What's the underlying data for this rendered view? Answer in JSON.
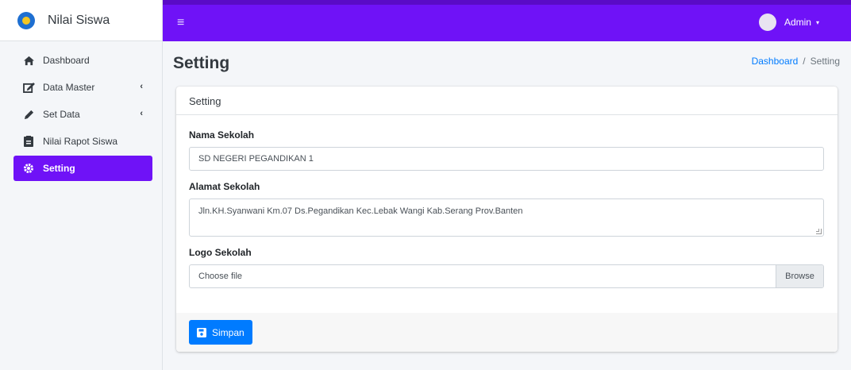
{
  "brand": {
    "name": "Nilai Siswa"
  },
  "sidebar": {
    "items": [
      {
        "label": "Dashboard",
        "icon": "home-icon"
      },
      {
        "label": "Data Master",
        "icon": "edit-icon",
        "caret": "‹"
      },
      {
        "label": "Set Data",
        "icon": "pencil-icon",
        "caret": "‹"
      },
      {
        "label": "Nilai Rapot Siswa",
        "icon": "clipboard-icon"
      },
      {
        "label": "Setting",
        "icon": "gear-icon",
        "active": true
      }
    ]
  },
  "topbar": {
    "menu_icon": "≡",
    "user_name": "Admin",
    "user_caret": "▾"
  },
  "page": {
    "title": "Setting"
  },
  "breadcrumb": {
    "home": "Dashboard",
    "separator": "/",
    "current": "Setting"
  },
  "card": {
    "header": "Setting",
    "fields": {
      "nama_label": "Nama Sekolah",
      "nama_value": "SD NEGERI PEGANDIKAN 1",
      "alamat_label": "Alamat Sekolah",
      "alamat_value": "Jln.KH.Syanwani Km.07 Ds.Pegandikan Kec.Lebak Wangi Kab.Serang Prov.Banten",
      "logo_label": "Logo Sekolah",
      "logo_placeholder": "Choose file",
      "browse_label": "Browse"
    },
    "save_label": "Simpan"
  },
  "colors": {
    "accent": "#6f12f7",
    "primary": "#007bff"
  }
}
